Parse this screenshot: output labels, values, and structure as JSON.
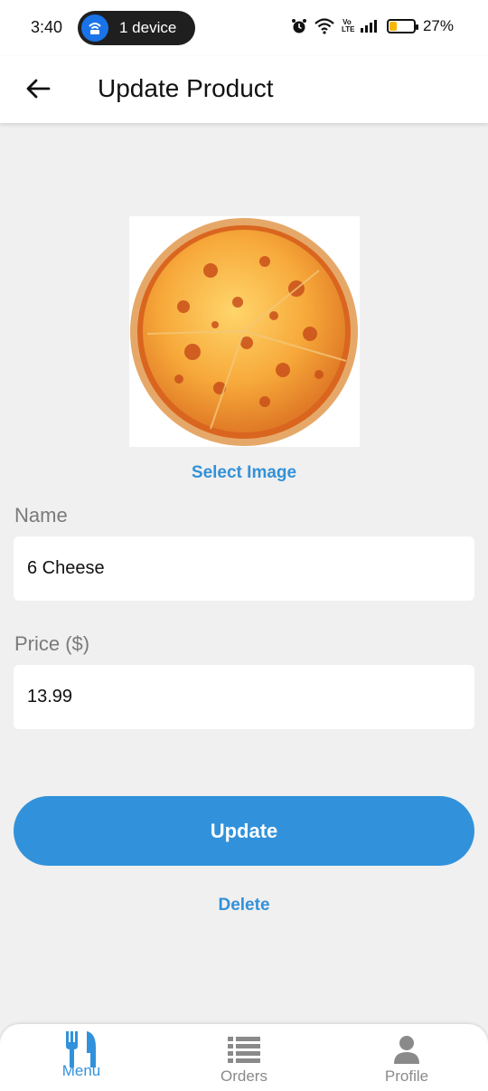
{
  "status_bar": {
    "time": "3:40",
    "device_pill": "1 device",
    "battery_percent": "27%",
    "battery_level": 0.27,
    "network_label": "Vo LTE"
  },
  "header": {
    "title": "Update Product",
    "back_icon": "arrow-left-icon"
  },
  "product": {
    "image_icon": "pizza-image",
    "select_image_label": "Select Image",
    "name_label": "Name",
    "name_value": "6 Cheese",
    "price_label": "Price ($)",
    "price_value": "13.99"
  },
  "actions": {
    "update_label": "Update",
    "delete_label": "Delete"
  },
  "bottom_nav": {
    "items": [
      {
        "label": "Menu",
        "icon": "fork-knife-icon",
        "active": true
      },
      {
        "label": "Orders",
        "icon": "list-icon",
        "active": false
      },
      {
        "label": "Profile",
        "icon": "person-icon",
        "active": false
      }
    ]
  },
  "colors": {
    "accent": "#3192db",
    "link": "#3391d8",
    "inactive": "#8a8a8a",
    "background": "#f0f0f0"
  }
}
